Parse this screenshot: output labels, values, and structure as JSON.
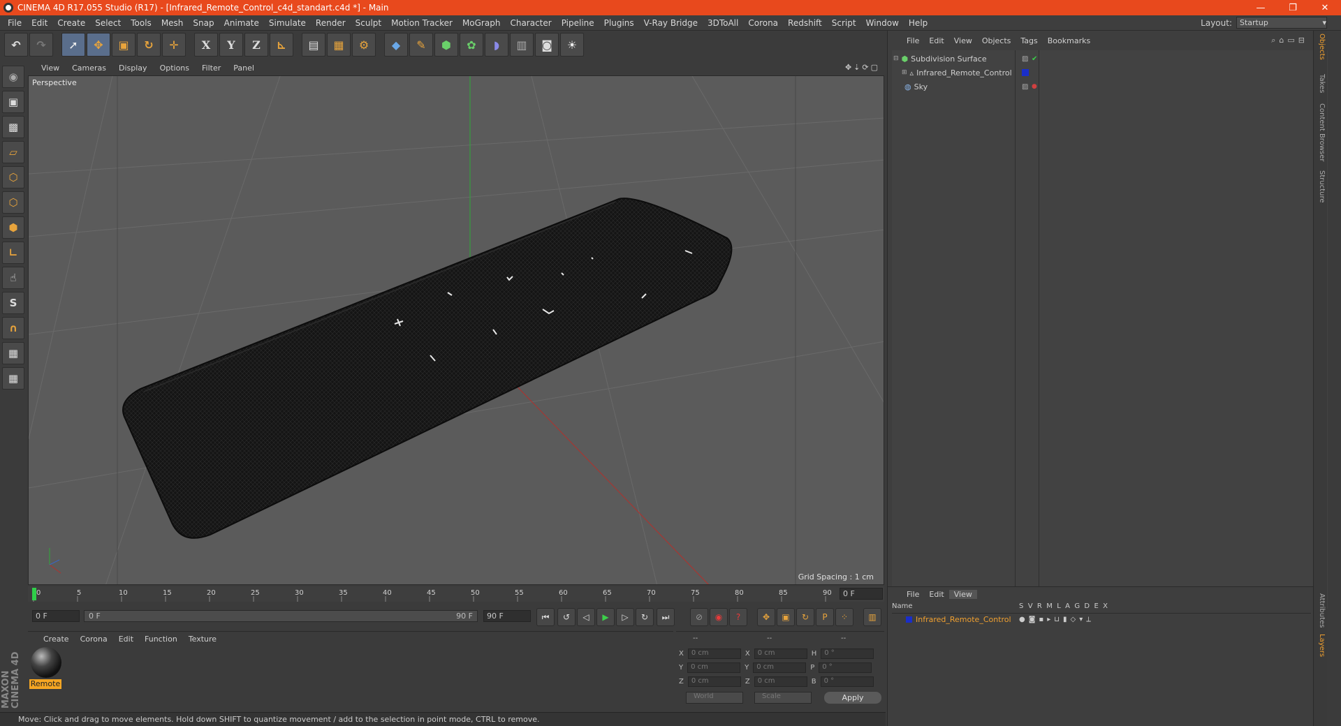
{
  "window": {
    "title": "CINEMA 4D R17.055 Studio (R17) - [Infrared_Remote_Control_c4d_standart.c4d *] - Main",
    "controls": [
      "—",
      "❐",
      "✕"
    ]
  },
  "menubar": {
    "items": [
      "File",
      "Edit",
      "Create",
      "Select",
      "Tools",
      "Mesh",
      "Snap",
      "Animate",
      "Simulate",
      "Render",
      "Sculpt",
      "Motion Tracker",
      "MoGraph",
      "Character",
      "Pipeline",
      "Plugins",
      "V-Ray Bridge",
      "3DToAll",
      "Corona",
      "Redshift",
      "Script",
      "Window",
      "Help"
    ],
    "layout_label": "Layout:",
    "layout_value": "Startup"
  },
  "viewport": {
    "menu": [
      "View",
      "Cameras",
      "Display",
      "Options",
      "Filter",
      "Panel"
    ],
    "label": "Perspective",
    "grid_spacing": "Grid Spacing : 1 cm"
  },
  "timeline": {
    "ticks": [
      "0",
      "5",
      "10",
      "15",
      "20",
      "25",
      "30",
      "35",
      "40",
      "45",
      "50",
      "55",
      "60",
      "65",
      "70",
      "75",
      "80",
      "85",
      "90"
    ],
    "end_field": "0 F",
    "start_field": "0 F",
    "slider_left": "0 F",
    "slider_right": "90 F",
    "max_field": "90 F"
  },
  "material_panel": {
    "menu": [
      "Create",
      "Corona",
      "Edit",
      "Function",
      "Texture"
    ],
    "material_name": "Remote"
  },
  "coords": {
    "headers": [
      "--",
      "--",
      "--"
    ],
    "rows": [
      {
        "a": "X",
        "v1": "0 cm",
        "b": "X",
        "v2": "0 cm",
        "c": "H",
        "v3": "0 °"
      },
      {
        "a": "Y",
        "v1": "0 cm",
        "b": "Y",
        "v2": "0 cm",
        "c": "P",
        "v3": "0 °"
      },
      {
        "a": "Z",
        "v1": "0 cm",
        "b": "Z",
        "v2": "0 cm",
        "c": "B",
        "v3": "0 °"
      }
    ],
    "world": "World",
    "scale": "Scale",
    "apply": "Apply"
  },
  "status": "Move: Click and drag to move elements. Hold down SHIFT to quantize movement / add to the selection in point mode, CTRL to remove.",
  "object_manager": {
    "menu": [
      "File",
      "Edit",
      "View",
      "Objects",
      "Tags",
      "Bookmarks"
    ],
    "objects": [
      "Subdivision Surface",
      "Infrared_Remote_Control",
      "Sky"
    ]
  },
  "side_tabs": [
    "Objects",
    "Takes",
    "Content Browser",
    "Structure",
    "Attributes",
    "Layers"
  ],
  "layers": {
    "menu": [
      "File",
      "Edit",
      "View"
    ],
    "header_name": "Name",
    "header_cols": "S  V  R  M  L  A  G  D  E  X",
    "row_name": "Infrared_Remote_Control"
  },
  "branding": "MAXON CINEMA 4D"
}
